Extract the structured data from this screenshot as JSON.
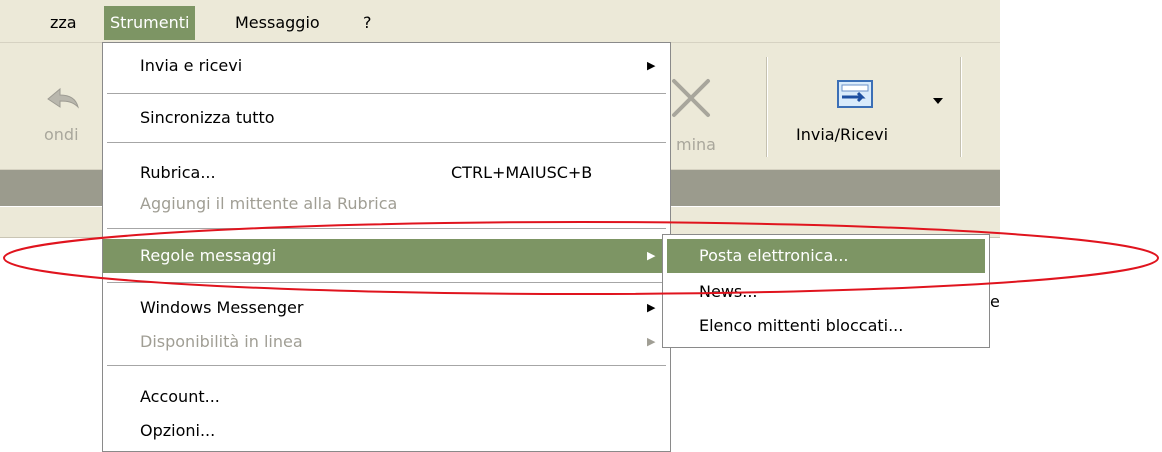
{
  "menubar": {
    "items": [
      {
        "label": "zza"
      },
      {
        "label": "Strumenti"
      },
      {
        "label": "Messaggio"
      },
      {
        "label": "?"
      }
    ]
  },
  "toolbar": {
    "reply_partial": "ondi",
    "delete_partial": "mina",
    "send_receive": "Invia/Ricevi"
  },
  "strumenti_menu": {
    "items": [
      {
        "label": "Invia e ricevi",
        "submenu": true
      },
      {
        "label": "Sincronizza tutto"
      },
      {
        "label": "Rubrica...",
        "shortcut": "CTRL+MAIUSC+B"
      },
      {
        "label": "Aggiungi il mittente alla Rubrica",
        "disabled": true
      },
      {
        "label": "Regole messaggi",
        "submenu": true,
        "highlighted": true
      },
      {
        "label": "Windows Messenger",
        "submenu": true
      },
      {
        "label": "Disponibilità in linea",
        "submenu": true,
        "disabled": true
      },
      {
        "label": "Account..."
      },
      {
        "label": "Opzioni..."
      }
    ]
  },
  "regole_submenu": {
    "items": [
      {
        "label": "Posta elettronica...",
        "highlighted": true
      },
      {
        "label": "News..."
      },
      {
        "label": "Elenco mittenti bloccati..."
      }
    ]
  },
  "stray_char": "e",
  "colors": {
    "highlight": "#7d9564",
    "annotation_ellipse": "#e0141e",
    "chrome": "#ece9d8"
  }
}
